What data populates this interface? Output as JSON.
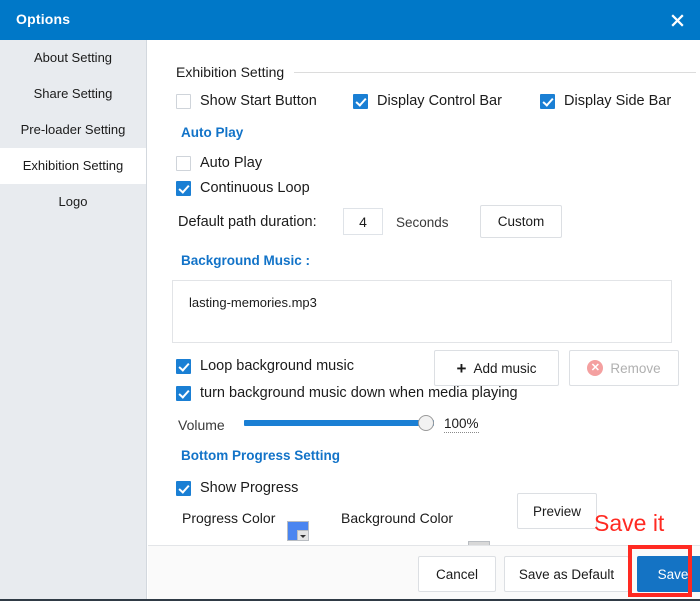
{
  "window": {
    "title": "Options",
    "close_icon": "close-icon"
  },
  "sidebar": {
    "items": [
      {
        "label": "About Setting",
        "active": false
      },
      {
        "label": "Share Setting",
        "active": false
      },
      {
        "label": "Pre-loader Setting",
        "active": false
      },
      {
        "label": "Exhibition Setting",
        "active": true
      },
      {
        "label": "Logo",
        "active": false
      }
    ]
  },
  "main": {
    "group_title": "Exhibition Setting",
    "checkboxes_top": [
      {
        "label": "Show Start Button",
        "checked": false
      },
      {
        "label": "Display Control Bar",
        "checked": true
      },
      {
        "label": "Display Side Bar",
        "checked": true
      }
    ],
    "auto_play": {
      "heading": "Auto Play",
      "auto_play": {
        "label": "Auto Play",
        "checked": false
      },
      "continuous_loop": {
        "label": "Continuous Loop",
        "checked": true
      },
      "duration_label": "Default path duration:",
      "duration_value": "4",
      "duration_unit": "Seconds",
      "custom_button": "Custom"
    },
    "background_music": {
      "heading": "Background Music :",
      "files": [
        "lasting-memories.mp3"
      ],
      "loop_music": {
        "label": "Loop background music",
        "checked": true
      },
      "duck_music": {
        "label": "turn background music down when media playing",
        "checked": true
      },
      "add_music_button": "Add music",
      "remove_button": "Remove",
      "volume_label": "Volume",
      "volume_value": "100%",
      "volume_percent": 100
    },
    "bottom_progress": {
      "heading": "Bottom Progress Setting",
      "show_progress": {
        "label": "Show Progress",
        "checked": true
      },
      "progress_color_label": "Progress Color",
      "progress_color": "#4a85f0",
      "background_color_label": "Background Color",
      "background_color": "#d8d8d8",
      "preview_button": "Preview"
    }
  },
  "footer": {
    "cancel_label": "Cancel",
    "save_as_default_label": "Save as Default",
    "save_label": "Save"
  },
  "annotations": {
    "save_it_text": "Save it",
    "highlight_color": "#ff2a22"
  },
  "theme": {
    "title_bar": "#0078c8",
    "accent_blue": "#1a7fd4",
    "heading_blue": "#1273c8",
    "sidebar_bg": "#e8ebef"
  }
}
